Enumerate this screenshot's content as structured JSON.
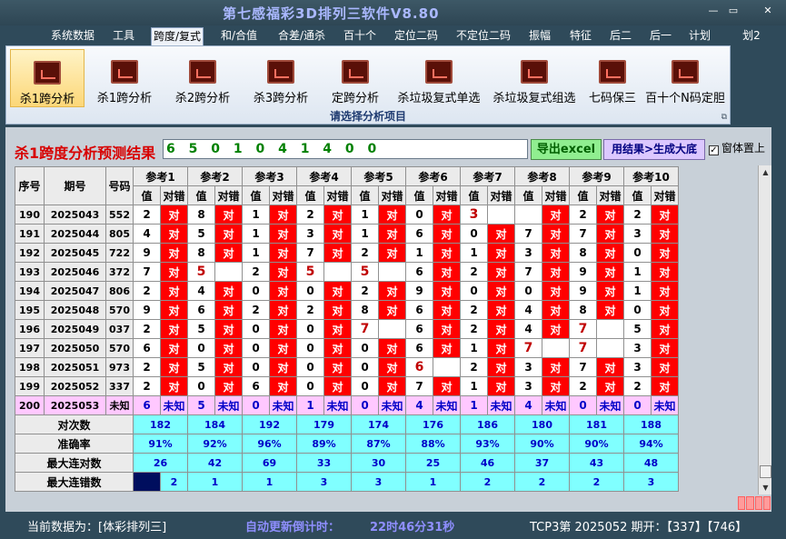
{
  "app": {
    "title": "第七感福彩3D排列三软件V8.80"
  },
  "window_buttons": {
    "minimize": "—",
    "restore": "▭",
    "close": "✕"
  },
  "menu": [
    "系统数据",
    "工具",
    "跨度/复式",
    "和/合值",
    "合差/通杀",
    "百十个",
    "定位二码",
    "不定位二码",
    "振幅",
    "特征",
    "后二",
    "后一",
    "计划",
    "划2"
  ],
  "ribbon": {
    "buttons": [
      "杀1跨分析",
      "杀1跨分析",
      "杀2跨分析",
      "杀3跨分析",
      "定跨分析",
      "杀垃圾复式单选",
      "杀垃圾复式组选",
      "七码保三",
      "百十个N码定胆"
    ],
    "caption": "请选择分析项目",
    "launcher": "⧉"
  },
  "panel": {
    "title": "杀1跨度分析预测结果",
    "result": "6 5 0 1 0 4 1 4 0 0",
    "export_btn": "导出excel",
    "generate_btn": "用结果>生成大底",
    "topmost_label": "窗体置上",
    "topmost_checked": "✓"
  },
  "table": {
    "headers": [
      "序号",
      "期号",
      "号码"
    ],
    "ref_labels": [
      "参考1",
      "参考2",
      "参考3",
      "参考4",
      "参考5",
      "参考6",
      "参考7",
      "参考8",
      "参考9",
      "参考10"
    ],
    "sub_val": "值",
    "sub_res": "对错",
    "correct_mark": "对",
    "rows": [
      {
        "seq": "190",
        "period": "2025043",
        "num": "552",
        "vals": [
          "2",
          "8",
          "1",
          "2",
          "1",
          "0",
          "3",
          "",
          "2",
          "2"
        ],
        "ok": [
          1,
          1,
          1,
          1,
          1,
          1,
          0,
          1,
          1,
          1
        ]
      },
      {
        "seq": "191",
        "period": "2025044",
        "num": "805",
        "vals": [
          "4",
          "5",
          "1",
          "3",
          "1",
          "6",
          "0",
          "7",
          "7",
          "3"
        ],
        "ok": [
          1,
          1,
          1,
          1,
          1,
          1,
          1,
          1,
          1,
          1
        ]
      },
      {
        "seq": "192",
        "period": "2025045",
        "num": "722",
        "vals": [
          "9",
          "8",
          "1",
          "7",
          "2",
          "1",
          "1",
          "3",
          "8",
          "0"
        ],
        "ok": [
          1,
          1,
          1,
          1,
          1,
          1,
          1,
          1,
          1,
          1
        ]
      },
      {
        "seq": "193",
        "period": "2025046",
        "num": "372",
        "vals": [
          "7",
          "5",
          "2",
          "5",
          "5",
          "6",
          "2",
          "7",
          "9",
          "1"
        ],
        "ok": [
          1,
          0,
          1,
          0,
          0,
          1,
          1,
          1,
          1,
          1
        ]
      },
      {
        "seq": "194",
        "period": "2025047",
        "num": "806",
        "vals": [
          "2",
          "4",
          "0",
          "0",
          "2",
          "9",
          "0",
          "0",
          "9",
          "1"
        ],
        "ok": [
          1,
          1,
          1,
          1,
          1,
          1,
          1,
          1,
          1,
          1
        ]
      },
      {
        "seq": "195",
        "period": "2025048",
        "num": "570",
        "vals": [
          "9",
          "6",
          "2",
          "2",
          "8",
          "6",
          "2",
          "4",
          "8",
          "0"
        ],
        "ok": [
          1,
          1,
          1,
          1,
          1,
          1,
          1,
          1,
          1,
          1
        ]
      },
      {
        "seq": "196",
        "period": "2025049",
        "num": "037",
        "vals": [
          "2",
          "5",
          "0",
          "0",
          "7",
          "6",
          "2",
          "4",
          "7",
          "5"
        ],
        "ok": [
          1,
          1,
          1,
          1,
          0,
          1,
          1,
          1,
          0,
          1
        ]
      },
      {
        "seq": "197",
        "period": "2025050",
        "num": "570",
        "vals": [
          "6",
          "0",
          "0",
          "0",
          "0",
          "6",
          "1",
          "7",
          "7",
          "3"
        ],
        "ok": [
          1,
          1,
          1,
          1,
          1,
          1,
          1,
          0,
          0,
          1
        ]
      },
      {
        "seq": "198",
        "period": "2025051",
        "num": "973",
        "vals": [
          "2",
          "5",
          "0",
          "0",
          "0",
          "6",
          "2",
          "3",
          "7",
          "3"
        ],
        "ok": [
          1,
          1,
          1,
          1,
          1,
          0,
          1,
          1,
          1,
          1
        ]
      },
      {
        "seq": "199",
        "period": "2025052",
        "num": "337",
        "vals": [
          "2",
          "0",
          "6",
          "0",
          "0",
          "7",
          "1",
          "3",
          "2",
          "2"
        ],
        "ok": [
          1,
          1,
          1,
          1,
          1,
          1,
          1,
          1,
          1,
          1
        ]
      }
    ],
    "pending": {
      "seq": "200",
      "period": "2025053",
      "num": "未知",
      "vals": [
        "6",
        "5",
        "0",
        "1",
        "0",
        "4",
        "1",
        "4",
        "0",
        "0"
      ],
      "res": "未知"
    },
    "stats": [
      {
        "label": "对次数",
        "values": [
          "182",
          "184",
          "192",
          "179",
          "174",
          "176",
          "186",
          "180",
          "181",
          "188"
        ]
      },
      {
        "label": "准确率",
        "values": [
          "91%",
          "92%",
          "96%",
          "89%",
          "87%",
          "88%",
          "93%",
          "90%",
          "90%",
          "94%"
        ]
      },
      {
        "label": "最大连对数",
        "values": [
          "26",
          "42",
          "69",
          "33",
          "30",
          "25",
          "46",
          "37",
          "43",
          "48"
        ]
      },
      {
        "label": "最大连错数",
        "values": [
          "2",
          "1",
          "1",
          "3",
          "3",
          "1",
          "2",
          "2",
          "2",
          "3"
        ]
      }
    ]
  },
  "scrollbar": {
    "up": "▲",
    "down": "▼"
  },
  "status": {
    "current_data": "当前数据为：[体彩排列三]",
    "countdown_label": "自动更新倒计时：",
    "countdown": "22时46分31秒",
    "draw": "TCP3第 2025052 期开：【337】【746】"
  },
  "colors": {
    "correct": "#ff0000",
    "pending": "#ffc8ff",
    "stats": "#80ffff",
    "accent": "#d80000"
  }
}
